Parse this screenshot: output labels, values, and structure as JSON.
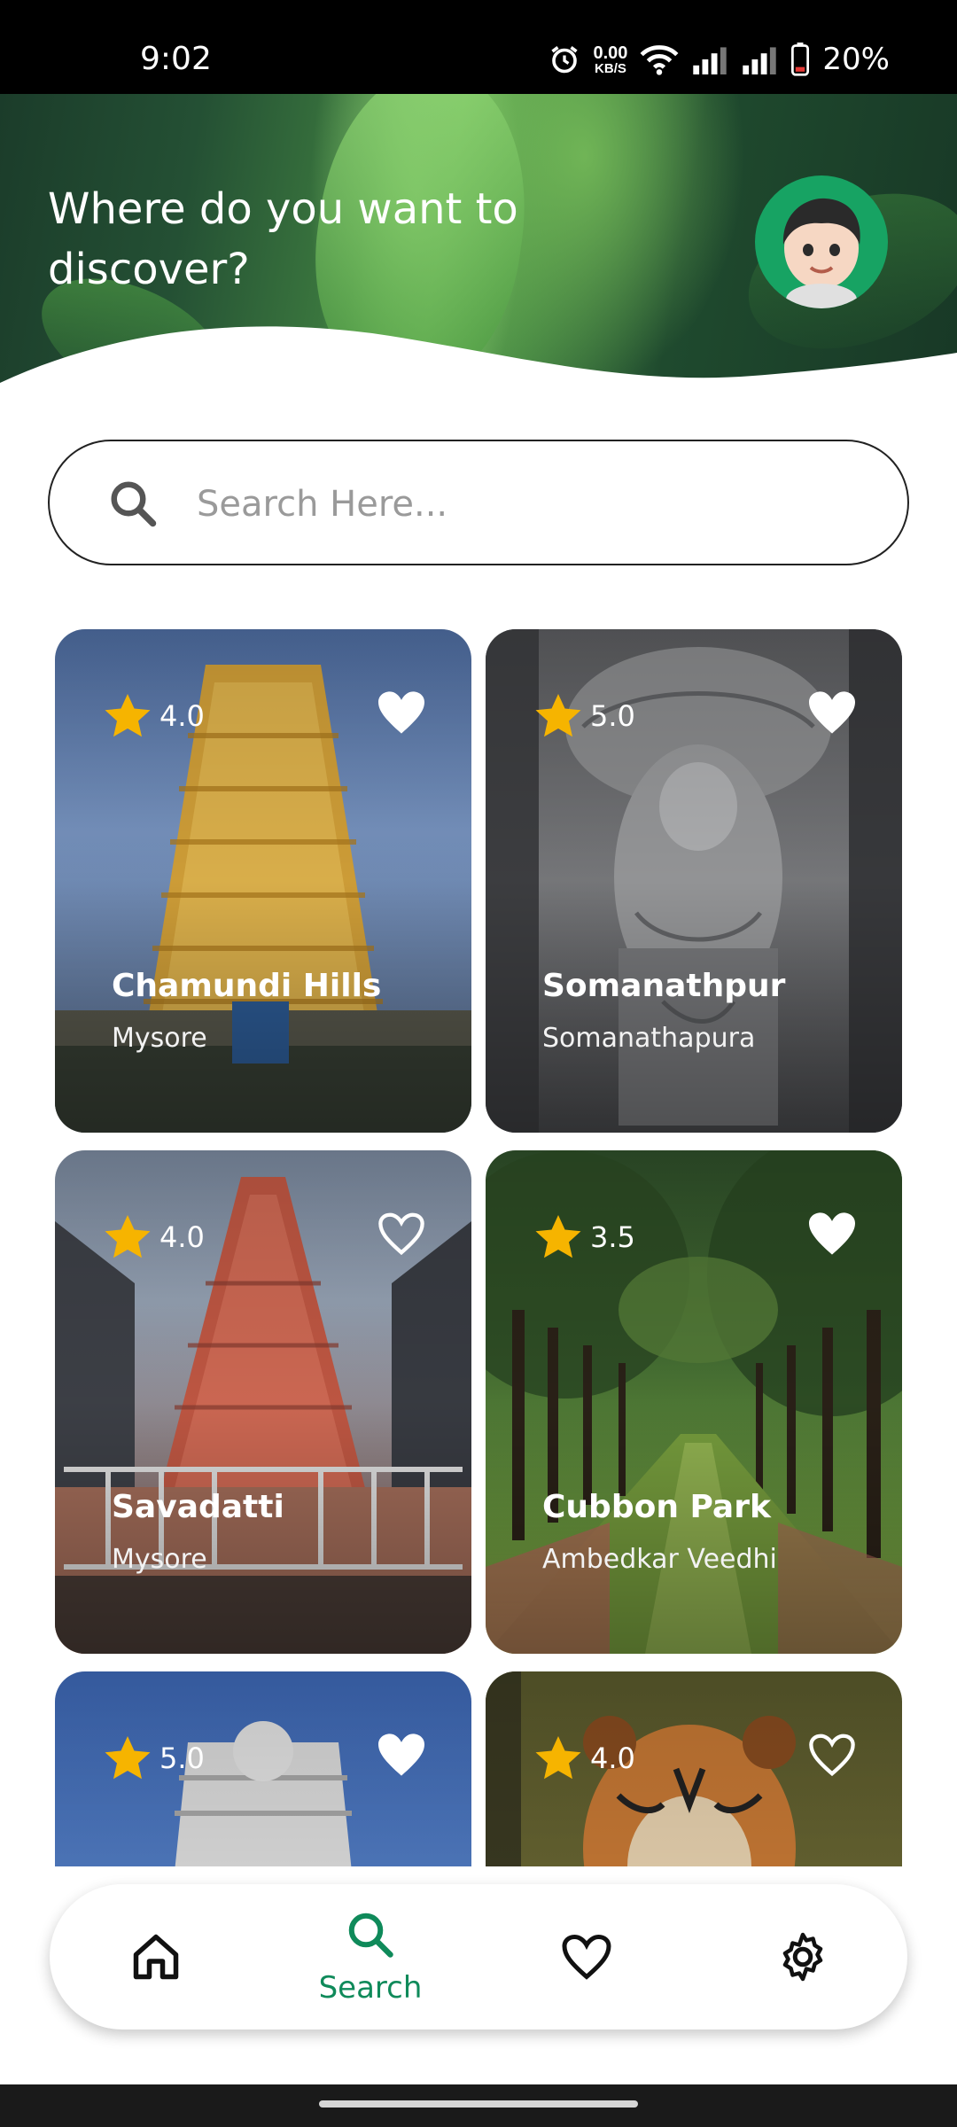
{
  "status_bar": {
    "time": "9:02",
    "net_speed_value": "0.00",
    "net_speed_unit": "KB/S",
    "battery": "20%"
  },
  "header": {
    "title": "Where do you want to discover?"
  },
  "search": {
    "placeholder": "Search Here..."
  },
  "places": [
    {
      "name": "Chamundi Hills",
      "city": "Mysore",
      "rating": "4.0",
      "favorite": true
    },
    {
      "name": "Somanathpur",
      "city": "Somanathapura",
      "rating": "5.0",
      "favorite": true
    },
    {
      "name": "Savadatti",
      "city": "Mysore",
      "rating": "4.0",
      "favorite": false
    },
    {
      "name": "Cubbon Park",
      "city": "Ambedkar Veedhi",
      "rating": "3.5",
      "favorite": true
    },
    {
      "name": "",
      "city": "",
      "rating": "5.0",
      "favorite": true
    },
    {
      "name": "",
      "city": "",
      "rating": "4.0",
      "favorite": false
    }
  ],
  "bottom_nav": {
    "items": [
      "home-icon",
      "search-icon",
      "heart-icon",
      "gear-icon"
    ],
    "active_label": "Search",
    "accent_color": "#0f8a5a"
  }
}
